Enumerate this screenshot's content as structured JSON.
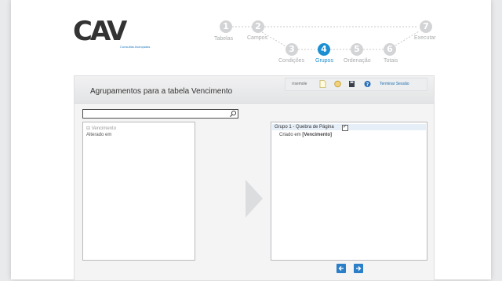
{
  "brand": {
    "logo_text": "CAV",
    "tagline": "Consultas Avançadas",
    "accent_color": "#1c8fd0"
  },
  "wizard": {
    "steps": [
      {
        "number": "1",
        "label": "Tabelas",
        "active": false
      },
      {
        "number": "2",
        "label": "Campos",
        "active": false
      },
      {
        "number": "3",
        "label": "Condições",
        "active": false
      },
      {
        "number": "4",
        "label": "Grupos",
        "active": true
      },
      {
        "number": "5",
        "label": "Ordenação",
        "active": false
      },
      {
        "number": "6",
        "label": "Totais",
        "active": false
      },
      {
        "number": "7",
        "label": "Executar",
        "active": false
      }
    ]
  },
  "panel": {
    "title": "Agrupamentos para a tabela Vencimento",
    "toolbar": {
      "user_label": "rrsemole",
      "new_icon": "new-document-icon",
      "open_icon": "folder-icon",
      "save_icon": "save-icon",
      "help_icon": "help-icon",
      "logout_label": "Terminar Sessão"
    },
    "search": {
      "value": "",
      "placeholder": ""
    },
    "fields_tree": {
      "root": "⊟ Vencimento",
      "items": [
        "Alterado em"
      ]
    },
    "groups": [
      {
        "label": "Grupo 1 - Quebra de Página",
        "checked": true,
        "items": [
          {
            "field": "Criado em",
            "table": "[Vencimento]"
          }
        ]
      }
    ]
  }
}
